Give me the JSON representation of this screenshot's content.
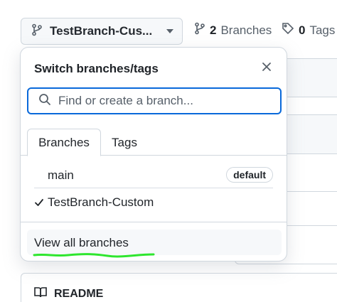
{
  "toolbar": {
    "branch_button_label": "TestBranch-Cus...",
    "branches_count": "2",
    "branches_label": "Branches",
    "tags_count": "0",
    "tags_label": "Tags"
  },
  "popup": {
    "title": "Switch branches/tags",
    "search_placeholder": "Find or create a branch...",
    "tabs": [
      {
        "label": "Branches",
        "active": true
      },
      {
        "label": "Tags",
        "active": false
      }
    ],
    "branches": [
      {
        "name": "main",
        "badge": "default",
        "selected": false
      },
      {
        "name": "TestBranch-Custom",
        "badge": "",
        "selected": true
      }
    ],
    "view_all_label": "View all branches"
  },
  "background": {
    "readme_label": "README"
  },
  "colors": {
    "accent": "#0969da",
    "highlight_scribble": "#2ee62e",
    "border": "#d0d7de",
    "muted": "#57606a"
  },
  "icons": {
    "branch_button": "git-branch-icon",
    "branches_stat": "git-branch-icon",
    "tags_stat": "tag-icon",
    "close": "close-icon",
    "search": "search-icon",
    "check": "check-icon",
    "readme": "book-icon"
  }
}
